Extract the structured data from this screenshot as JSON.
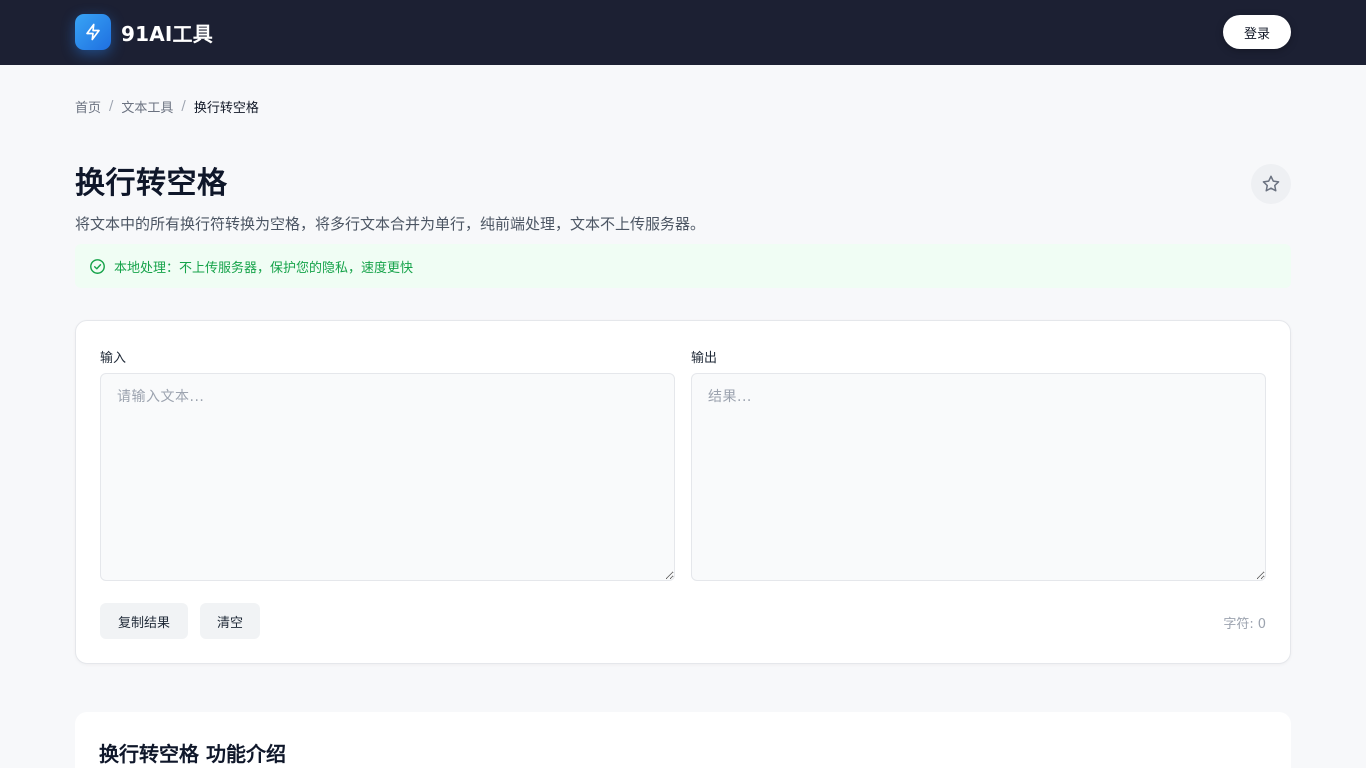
{
  "header": {
    "brand": "91AI工具",
    "logo_icon": "bolt-icon",
    "login_label": "登录"
  },
  "breadcrumb": {
    "home": "首页",
    "category": "文本工具",
    "current": "换行转空格",
    "separator": "/"
  },
  "page": {
    "title": "换行转空格",
    "description": "将文本中的所有换行符转换为空格，将多行文本合并为单行，纯前端处理，文本不上传服务器。",
    "favorite_icon": "star-icon"
  },
  "notice": {
    "icon": "check-circle-icon",
    "text": "本地处理：不上传服务器，保护您的隐私，速度更快"
  },
  "tool": {
    "input_label": "输入",
    "input_placeholder": "请输入文本...",
    "input_value": "",
    "output_label": "输出",
    "output_placeholder": "结果...",
    "output_value": "",
    "copy_label": "复制结果",
    "clear_label": "清空",
    "char_count_label": "字符:",
    "char_count_value": "0"
  },
  "intro": {
    "title": "换行转空格 功能介绍"
  },
  "colors": {
    "header_bg": "#1c2033",
    "accent": "#1f6fe0",
    "success": "#16a34a",
    "success_bg": "#f0fdf4",
    "page_bg": "#f7f8fa"
  }
}
